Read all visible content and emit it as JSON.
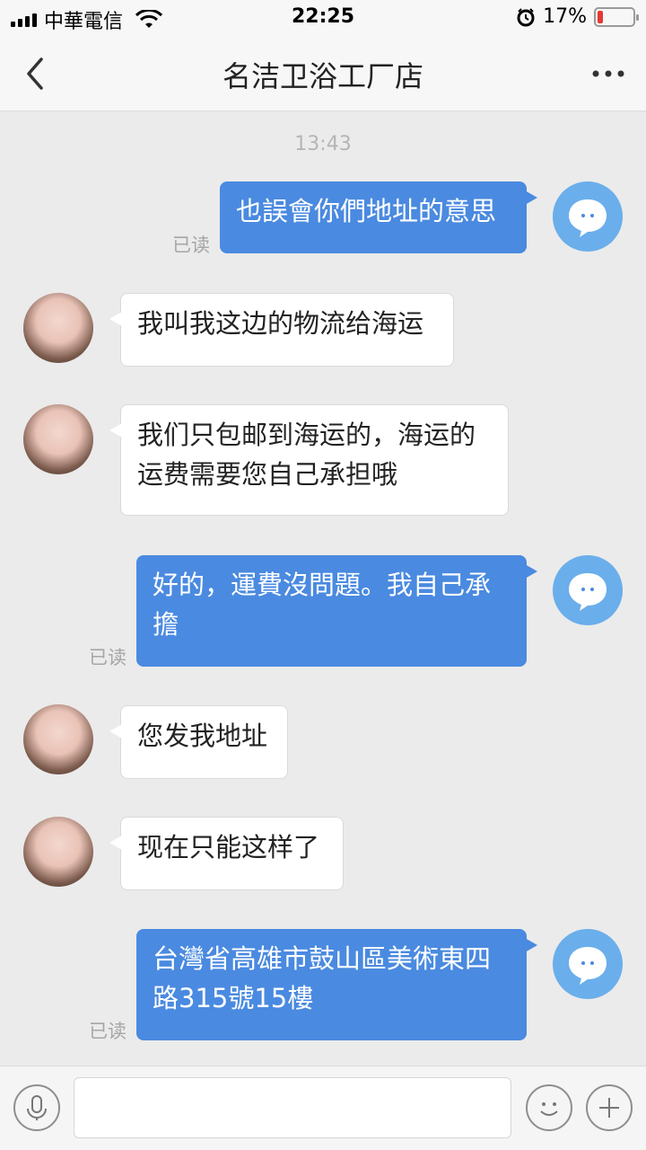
{
  "status_bar": {
    "carrier": "中華電信",
    "time": "22:25",
    "battery": "17%",
    "battery_level": 0.17
  },
  "nav": {
    "title": "名洁卫浴工厂店"
  },
  "chat": {
    "time_label": "13:43",
    "read_label": "已读",
    "messages": [
      {
        "from": "self",
        "text": "也誤會你們地址的意思",
        "read": true
      },
      {
        "from": "other",
        "text": "我叫我这边的物流给海运"
      },
      {
        "from": "other",
        "text": "我们只包邮到海运的，海运的运费需要您自己承担哦"
      },
      {
        "from": "self",
        "text": "好的，運費沒問題。我自己承擔",
        "read": true
      },
      {
        "from": "other",
        "text": "您发我地址"
      },
      {
        "from": "other",
        "text": "现在只能这样了"
      },
      {
        "from": "self",
        "text": "台灣省高雄市鼓山區美術東四路315號15樓",
        "read": true
      }
    ]
  },
  "input": {
    "value": "",
    "placeholder": ""
  },
  "colors": {
    "outgoing_bubble": "#4a8ae0",
    "self_avatar": "#6aaeeb",
    "background": "#ebebeb"
  }
}
